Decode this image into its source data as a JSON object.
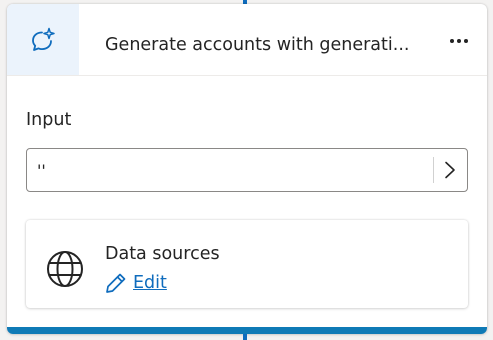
{
  "node": {
    "title": "Generate accounts with generati...",
    "icon": "copilot-chat-sparkle-icon",
    "more_icon": "more-horizontal-icon"
  },
  "input": {
    "label": "Input",
    "value": "''",
    "submit_icon": "chevron-right-icon"
  },
  "data_sources": {
    "title": "Data sources",
    "icon": "globe-icon",
    "edit_label": "Edit",
    "edit_icon": "pencil-icon"
  },
  "colors": {
    "accent": "#0f6cbd",
    "bottom_bar": "#0f7ab6",
    "icon_box_bg": "#ebf3fc"
  }
}
